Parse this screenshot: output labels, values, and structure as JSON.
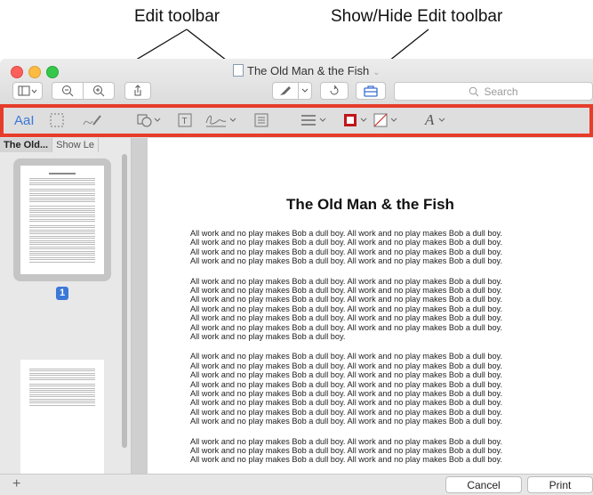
{
  "callouts": {
    "edit_toolbar": "Edit toolbar",
    "show_hide": "Show/Hide Edit toolbar"
  },
  "window": {
    "title": "The Old Man & the Fish",
    "search_placeholder": "Search"
  },
  "edit_toolbar": {
    "text_style_label": "AaI",
    "font_glyph": "A"
  },
  "sidebar": {
    "tab_active": "The Old...",
    "tab_inactive": "Show Le",
    "page_number": "1",
    "add_label": "+"
  },
  "document": {
    "heading": "The Old Man & the Fish",
    "paragraphs": [
      [
        "All work and no play makes Bob a dull boy. All work and no play makes Bob a dull boy.",
        "All work and no play makes Bob a dull boy. All work and no play makes Bob a dull boy.",
        "All work and no play makes Bob a dull boy. All work and no play makes Bob a dull boy.",
        "All work and no play makes Bob a dull boy. All work and no play makes Bob a dull boy."
      ],
      [
        "All work and no play makes Bob a dull boy. All work and no play makes Bob a dull boy.",
        "All work and no play makes Bob a dull boy. All work and no play makes Bob a dull boy.",
        "All work and no play makes Bob a dull boy. All work and no play makes Bob a dull boy.",
        "All work and no play makes Bob a dull boy. All work and no play makes Bob a dull boy.",
        "All work and no play makes Bob a dull boy. All work and no play makes Bob a dull boy.",
        "All work and no play makes Bob a dull boy. All work and no play makes Bob a dull boy.",
        "All work and no play makes Bob a dull boy."
      ],
      [
        "All work and no play makes Bob a dull boy. All work and no play makes Bob a dull boy.",
        "All work and no play makes Bob a dull boy. All work and no play makes Bob a dull boy.",
        "All work and no play makes Bob a dull boy. All work and no play makes Bob a dull boy.",
        "All work and no play makes Bob a dull boy. All work and no play makes Bob a dull boy.",
        "All work and no play makes Bob a dull boy. All work and no play makes Bob a dull boy.",
        "All work and no play makes Bob a dull boy. All work and no play makes Bob a dull boy.",
        "All work and no play makes Bob a dull boy. All work and no play makes Bob a dull boy.",
        "All work and no play makes Bob a dull boy. All work and no play makes Bob a dull boy."
      ],
      [
        "All work and no play makes Bob a dull boy. All work and no play makes Bob a dull boy.",
        "All work and no play makes Bob a dull boy. All work and no play makes Bob a dull boy.",
        "All work and no play makes Bob a dull boy. All work and no play makes Bob a dull boy."
      ]
    ]
  },
  "buttons": {
    "cancel": "Cancel",
    "print": "Print"
  },
  "colors": {
    "highlight": "#e63d2b",
    "border_color_swatch": "#c0161b",
    "page_badge": "#3c78d8"
  }
}
